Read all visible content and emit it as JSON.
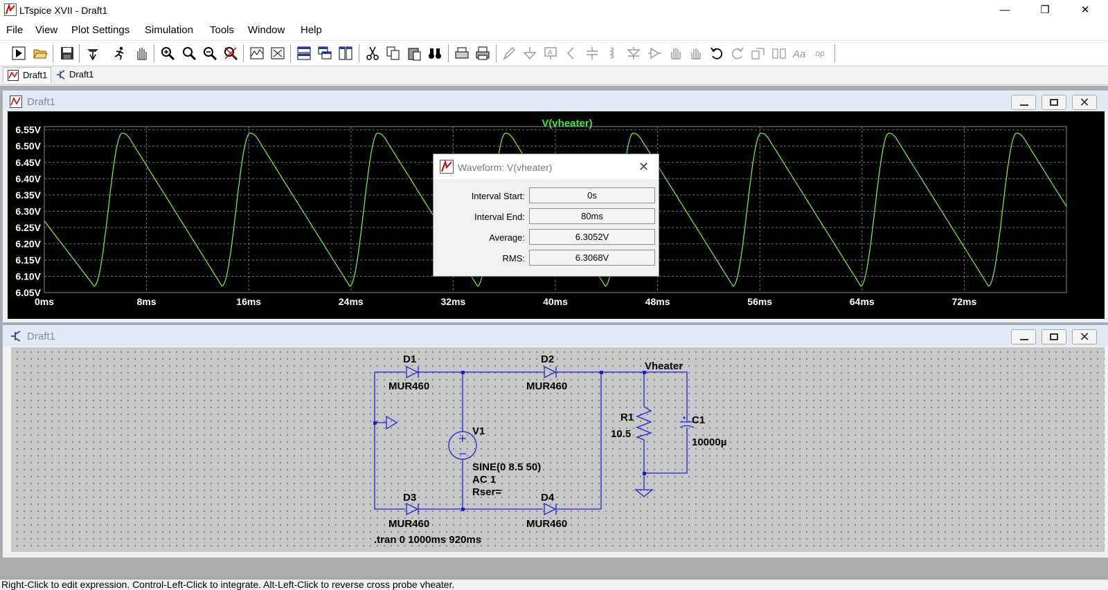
{
  "window": {
    "title": "LTspice XVII - Draft1",
    "controls": {
      "minimize": "—",
      "restore": "❐",
      "close": "✕"
    }
  },
  "menu": {
    "items": [
      "File",
      "View",
      "Plot Settings",
      "Simulation",
      "Tools",
      "Window",
      "Help"
    ]
  },
  "toolbar": {
    "icons": [
      "new-schematic",
      "open",
      "save",
      "control-panel",
      "run",
      "halt",
      "zoom-area",
      "zoom-in",
      "zoom-out",
      "zoom-fit",
      "autorange",
      "zoom-cancel",
      "tile-horizontal",
      "cascade",
      "tile-vertical",
      "cut",
      "copy",
      "paste",
      "find",
      "print-setup",
      "print",
      "wire",
      "ground",
      "label-net",
      "component",
      "resistor",
      "capacitor",
      "inductor",
      "diode",
      "component-symbol",
      "move",
      "drag",
      "undo",
      "redo",
      "rotate",
      "mirror",
      "text",
      "spice-directive"
    ]
  },
  "tabs": [
    {
      "label": "Draft1",
      "kind": "waveform"
    },
    {
      "label": "Draft1",
      "kind": "schematic"
    }
  ],
  "waveform_window": {
    "title": "Draft1"
  },
  "schematic_window": {
    "title": "Draft1"
  },
  "chart_data": {
    "type": "line",
    "title": "V(vheater)",
    "series": [
      {
        "name": "V(vheater)",
        "color": "#7fe83a"
      }
    ],
    "x_ticks": [
      "0ms",
      "8ms",
      "16ms",
      "24ms",
      "32ms",
      "40ms",
      "48ms",
      "56ms",
      "64ms",
      "72ms"
    ],
    "y_ticks": [
      "6.55V",
      "6.50V",
      "6.45V",
      "6.40V",
      "6.35V",
      "6.30V",
      "6.25V",
      "6.20V",
      "6.15V",
      "6.10V",
      "6.05V"
    ],
    "xlim": [
      0,
      80
    ],
    "ylim": [
      6.05,
      6.56
    ],
    "x_unit": "ms",
    "grid": true,
    "waveform": {
      "period_ms": 10,
      "peak_v": 6.54,
      "trough_v": 6.07,
      "first_peak_ms": 6.1,
      "first_trough_ms": 3.9,
      "start_v": 6.27
    }
  },
  "dialog": {
    "title": "Waveform: V(vheater)",
    "rows": [
      {
        "label": "Interval Start:",
        "value": "0s"
      },
      {
        "label": "Interval End:",
        "value": "80ms"
      },
      {
        "label": "Average:",
        "value": "6.3052V"
      },
      {
        "label": "RMS:",
        "value": "6.3068V"
      }
    ]
  },
  "schematic": {
    "components": {
      "D1": {
        "name": "D1",
        "model": "MUR460"
      },
      "D2": {
        "name": "D2",
        "model": "MUR460"
      },
      "D3": {
        "name": "D3",
        "model": "MUR460"
      },
      "D4": {
        "name": "D4",
        "model": "MUR460"
      },
      "V1": {
        "name": "V1",
        "value": "SINE(0 8.5 50)",
        "ac": "AC 1",
        "rser": "Rser="
      },
      "R1": {
        "name": "R1",
        "value": "10.5"
      },
      "C1": {
        "name": "C1",
        "value": "10000µ"
      }
    },
    "net_label": "Vheater",
    "directive": ".tran 0 1000ms 920ms"
  },
  "status": {
    "text": "Right-Click to edit expression. Control-Left-Click to integrate. Alt-Left-Click to reverse cross probe vheater."
  }
}
